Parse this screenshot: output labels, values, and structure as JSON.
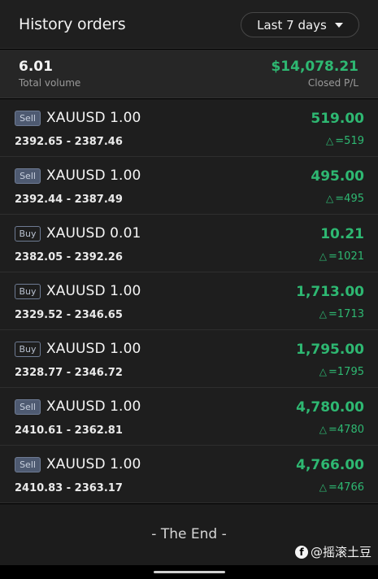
{
  "header": {
    "title": "History orders",
    "range_label": "Last 7 days"
  },
  "summary": {
    "total_volume": "6.01",
    "total_volume_label": "Total volume",
    "closed_pl": "$14,078.21",
    "closed_pl_label": "Closed P/L"
  },
  "orders": [
    {
      "side": "Sell",
      "symbol": "XAUUSD 1.00",
      "prices": "2392.65 - 2387.46",
      "profit": "519.00",
      "delta": "=519"
    },
    {
      "side": "Sell",
      "symbol": "XAUUSD 1.00",
      "prices": "2392.44 - 2387.49",
      "profit": "495.00",
      "delta": "=495"
    },
    {
      "side": "Buy",
      "symbol": "XAUUSD 0.01",
      "prices": "2382.05 - 2392.26",
      "profit": "10.21",
      "delta": "=1021"
    },
    {
      "side": "Buy",
      "symbol": "XAUUSD 1.00",
      "prices": "2329.52 - 2346.65",
      "profit": "1,713.00",
      "delta": "=1713"
    },
    {
      "side": "Buy",
      "symbol": "XAUUSD 1.00",
      "prices": "2328.77 - 2346.72",
      "profit": "1,795.00",
      "delta": "=1795"
    },
    {
      "side": "Sell",
      "symbol": "XAUUSD 1.00",
      "prices": "2410.61 - 2362.81",
      "profit": "4,780.00",
      "delta": "=4780"
    },
    {
      "side": "Sell",
      "symbol": "XAUUSD 1.00",
      "prices": "2410.83 - 2363.17",
      "profit": "4,766.00",
      "delta": "=4766"
    }
  ],
  "footer": {
    "end_text": "- The End -"
  },
  "watermark": {
    "text": "@摇滚土豆"
  },
  "colors": {
    "profit_green": "#2eb872",
    "sell_badge": "#4e5a71",
    "background": "#1e1e1e"
  }
}
